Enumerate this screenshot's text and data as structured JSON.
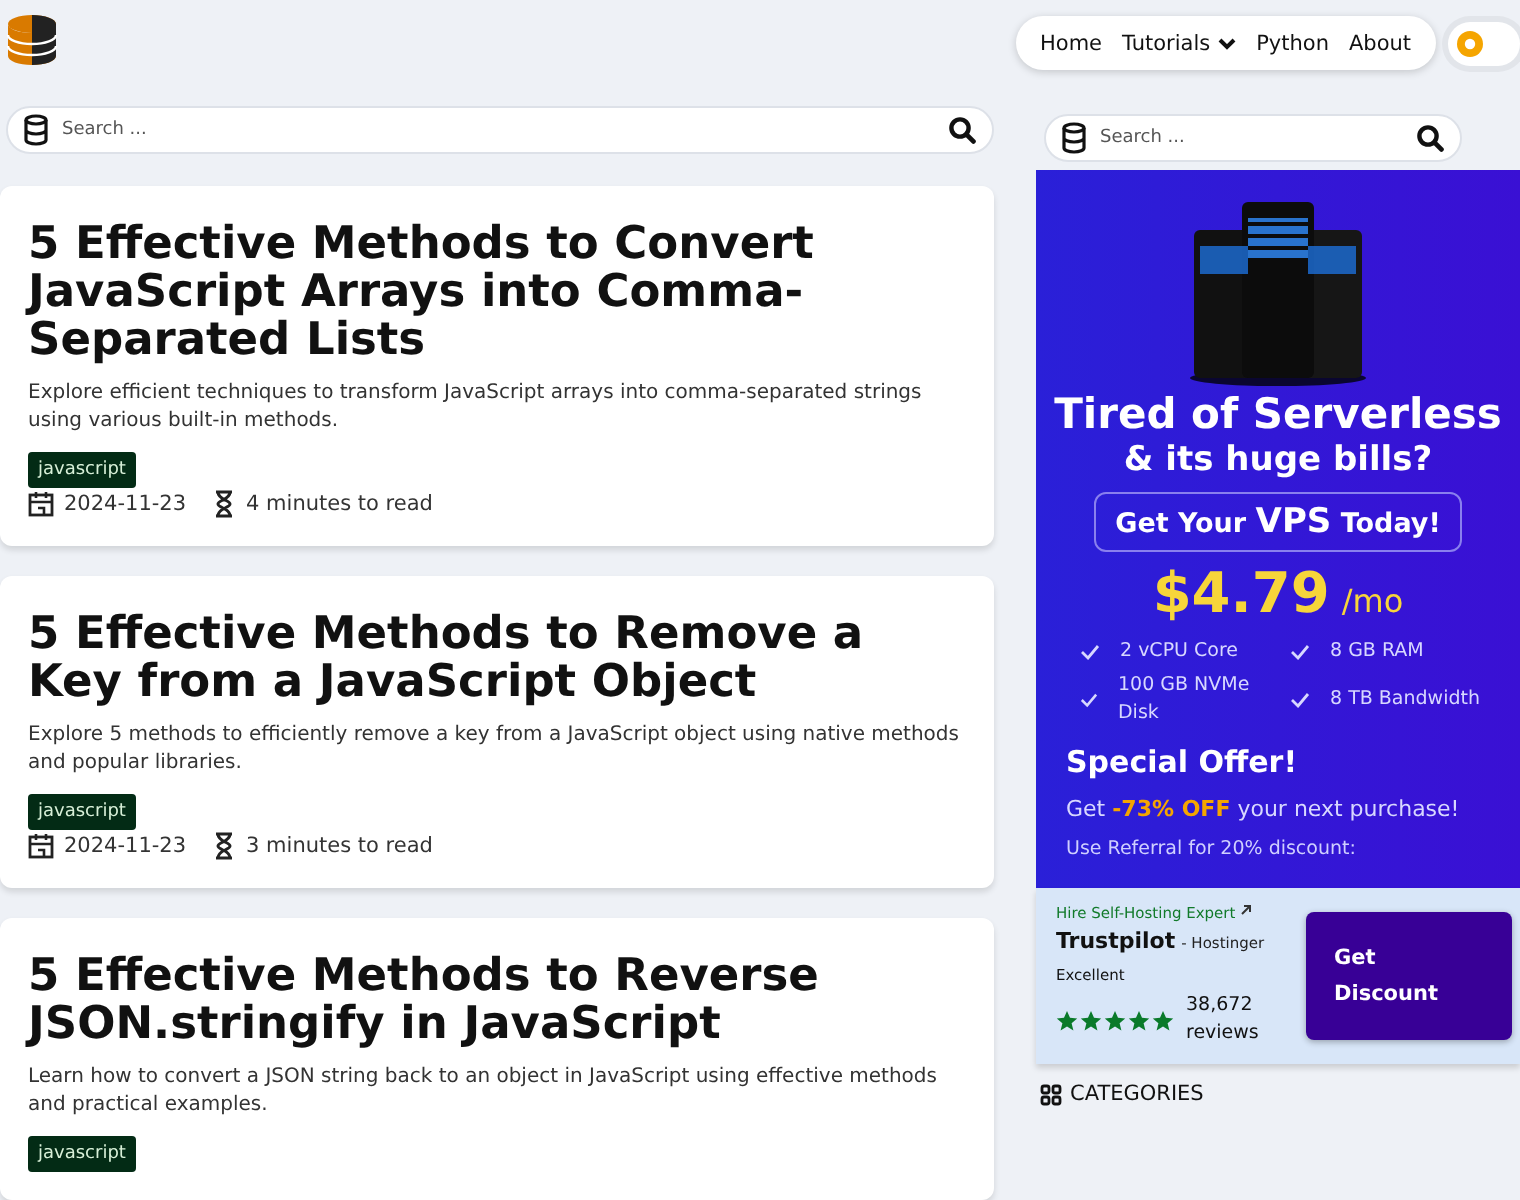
{
  "nav": {
    "items": [
      {
        "label": "Home",
        "dropdown": false
      },
      {
        "label": "Tutorials",
        "dropdown": true
      },
      {
        "label": "Python",
        "dropdown": false
      },
      {
        "label": "About",
        "dropdown": false
      }
    ]
  },
  "theme_toggle": {
    "on": false
  },
  "search": {
    "placeholder": "Search ..."
  },
  "articles": [
    {
      "title": "5 Effective Methods to Convert JavaScript Arrays into Comma-Separated Lists",
      "summary": "Explore efficient techniques to transform JavaScript arrays into comma-separated strings using various built-in methods.",
      "tag": "javascript",
      "date": "2024-11-23",
      "read_time": "4 minutes to read"
    },
    {
      "title": "5 Effective Methods to Remove a Key from a JavaScript Object",
      "summary": "Explore 5 methods to efficiently remove a key from a JavaScript object using native methods and popular libraries.",
      "tag": "javascript",
      "date": "2024-11-23",
      "read_time": "3 minutes to read"
    },
    {
      "title": "5 Effective Methods to Reverse JSON.stringify in JavaScript",
      "summary": "Learn how to convert a JSON string back to an object in JavaScript using effective methods and practical examples.",
      "tag": "javascript"
    }
  ],
  "sidebar": {
    "search": {
      "placeholder": "Search ..."
    },
    "ad": {
      "headline": "Tired of Serverless",
      "subheadline": "& its huge bills?",
      "cta": {
        "before": "Get Your ",
        "emphasis": "VPS",
        "after": " Today!"
      },
      "price": "$4.79",
      "period": "/mo",
      "features": [
        "2 vCPU Core",
        "8 GB RAM",
        "100 GB NVMe Disk",
        "8 TB Bandwidth"
      ],
      "offer_title": "Special Offer!",
      "offer_text": "Get **-73% OFF** your next purchase!",
      "referral": "Use Referral for 20% discount:",
      "review": {
        "hire": "Hire Self-Hosting Expert",
        "brand": "Trustpilot",
        "brand_note": "- Hostinger",
        "rating": "Excellent",
        "stars": 5,
        "count": "38,672",
        "count_label": "reviews"
      },
      "button": "Get Discount"
    },
    "categories": {
      "title": "CATEGORIES"
    }
  }
}
